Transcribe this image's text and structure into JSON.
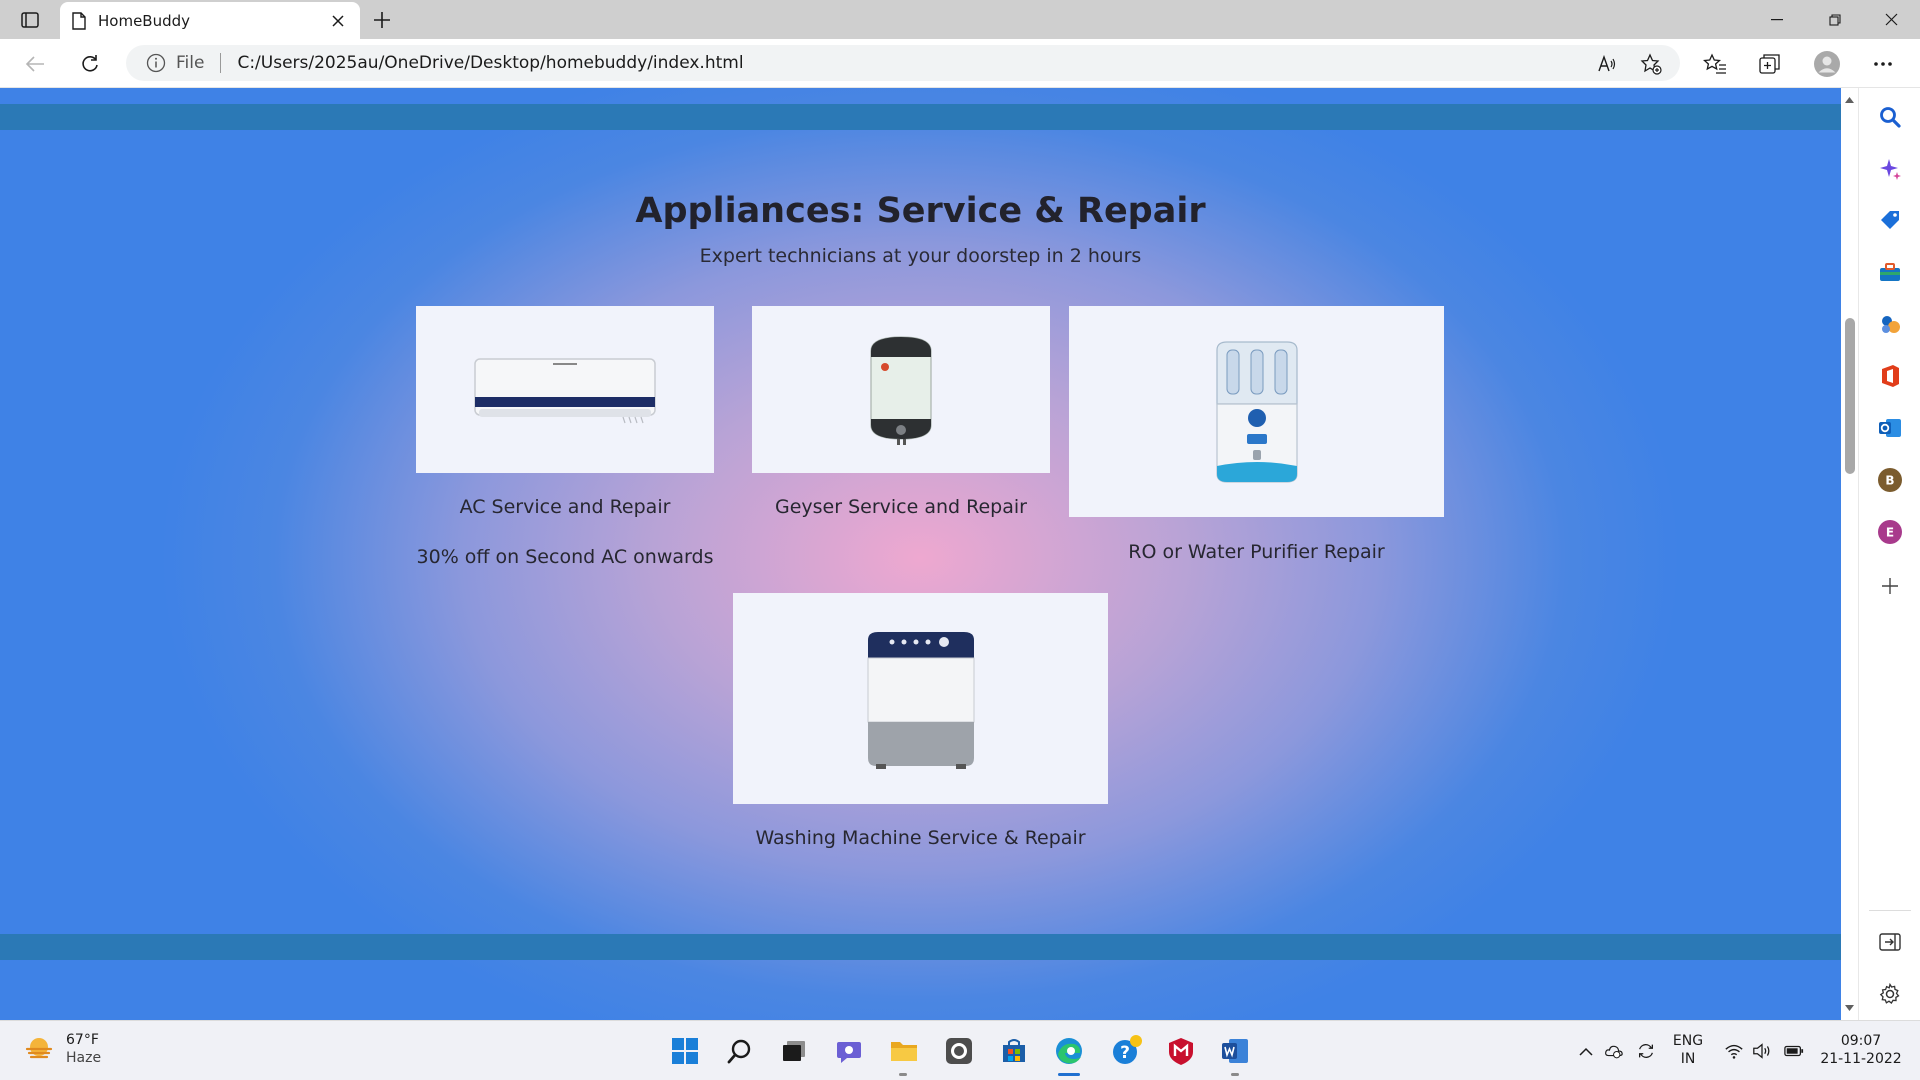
{
  "browser": {
    "tab_title": "HomeBuddy",
    "file_label": "File",
    "url": "C:/Users/2025au/OneDrive/Desktop/homebuddy/index.html"
  },
  "page": {
    "heading": "Appliances: Service & Repair",
    "subheading": "Expert technicians at your doorstep in 2 hours",
    "services": [
      {
        "name": "AC Service and Repair",
        "offer": "30% off on Second AC onwards"
      },
      {
        "name": "Geyser Service and Repair"
      },
      {
        "name": "RO or Water Purifier Repair"
      },
      {
        "name": "Washing Machine Service & Repair"
      }
    ]
  },
  "sidebar": {
    "profile_b": "B",
    "profile_e": "E"
  },
  "taskbar": {
    "weather_temp": "67°F",
    "weather_condition": "Haze",
    "lang_top": "ENG",
    "lang_bottom": "IN",
    "time": "09:07",
    "date": "21-11-2022"
  },
  "colors": {
    "band": "#2b79b6",
    "page_center": "#eea8d0",
    "page_edge": "#3f82e6",
    "card_bg": "#f1f3fb"
  }
}
